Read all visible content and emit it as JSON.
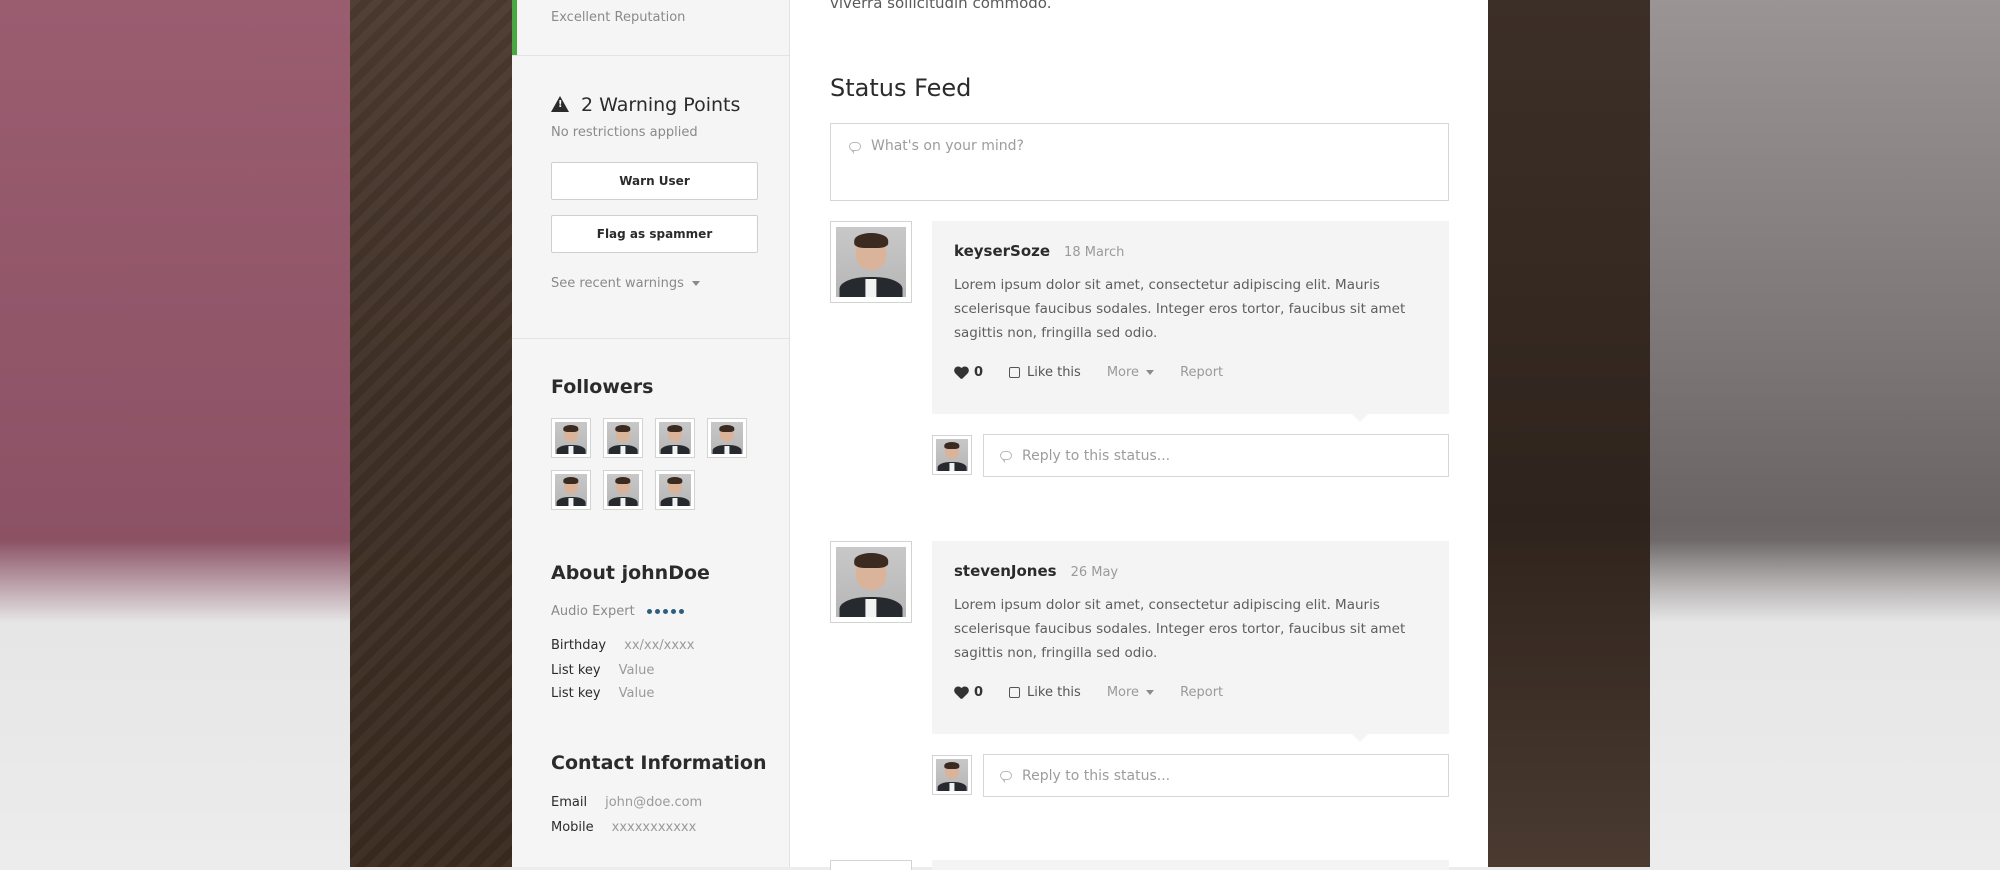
{
  "sidebar": {
    "reputation_label": "Excellent Reputation",
    "warnings": {
      "title": "2 Warning Points",
      "subtitle": "No restrictions applied",
      "warn_button": "Warn User",
      "flag_button": "Flag as spammer",
      "recent_link": "See recent warnings"
    },
    "followers_title": "Followers",
    "about": {
      "title": "About johnDoe",
      "role": "Audio Expert",
      "rating": 5,
      "rows": [
        {
          "key": "Birthday",
          "value": "xx/xx/xxxx"
        },
        {
          "key": "List key",
          "value": "Value"
        },
        {
          "key": "List key",
          "value": "Value"
        }
      ]
    },
    "contact": {
      "title": "Contact Information",
      "rows": [
        {
          "key": "Email",
          "value": "john@doe.com"
        },
        {
          "key": "Mobile",
          "value": "xxxxxxxxxxx"
        }
      ]
    }
  },
  "main": {
    "intro_text": "viverra sollicitudin commodo.",
    "feed_title": "Status Feed",
    "compose_placeholder": "What's on your mind?",
    "posts": [
      {
        "user": "keyserSoze",
        "date": "18 March",
        "body": "Lorem ipsum dolor sit amet, consectetur adipiscing elit. Mauris scelerisque faucibus sodales. Integer eros tortor, faucibus sit amet sagittis non, fringilla sed odio.",
        "likes": "0",
        "like_label": "Like this",
        "more_label": "More",
        "report_label": "Report",
        "reply_placeholder": "Reply to this status..."
      },
      {
        "user": "stevenJones",
        "date": "26 May",
        "body": "Lorem ipsum dolor sit amet, consectetur adipiscing elit. Mauris scelerisque faucibus sodales. Integer eros tortor, faucibus sit amet sagittis non, fringilla sed odio.",
        "likes": "0",
        "like_label": "Like this",
        "more_label": "More",
        "report_label": "Report",
        "reply_placeholder": "Reply to this status..."
      }
    ]
  },
  "colors": {
    "accent_green": "#4aa843",
    "rating_dot": "#2c5f7c"
  }
}
